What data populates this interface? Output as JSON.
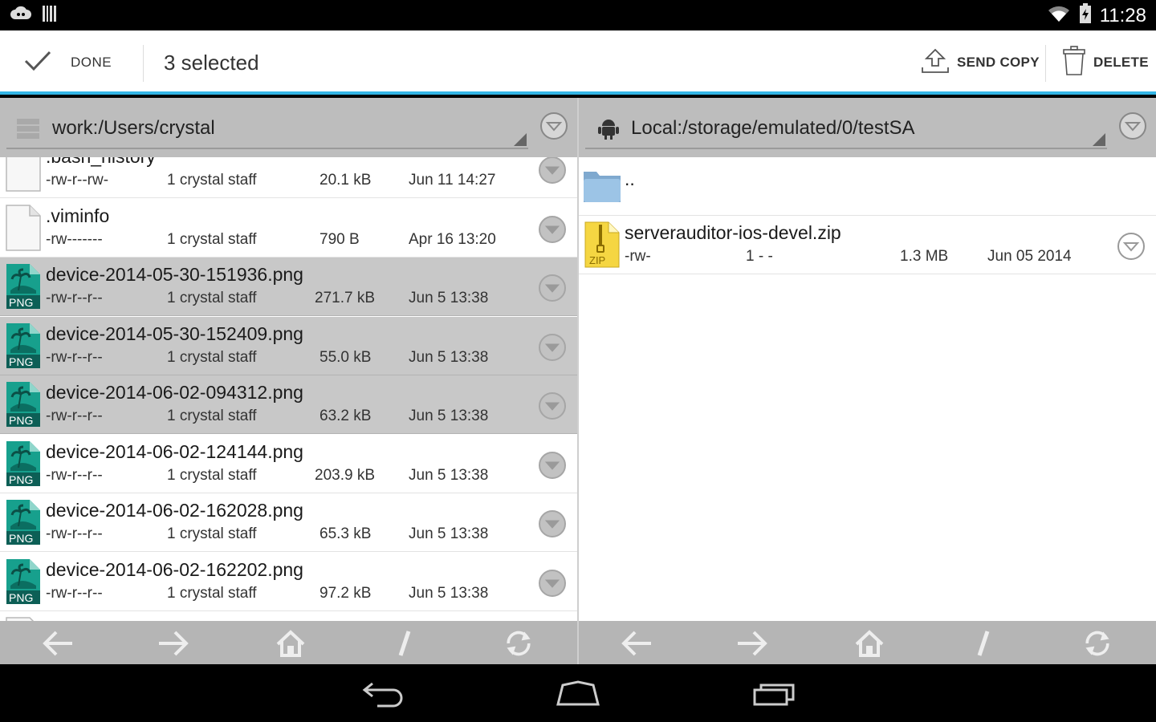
{
  "status": {
    "time": "11:28"
  },
  "actionbar": {
    "done_label": "DONE",
    "selected_label": "3 selected",
    "send_copy_label": "SEND COPY",
    "delete_label": "DELETE"
  },
  "left_pane": {
    "path": "work:/Users/crystal",
    "rows": [
      {
        "name": ".bash_history",
        "perms": "-rw-r--rw-",
        "owner": "1 crystal staff",
        "size": "20.1 kB",
        "date": "Jun 11 14:27",
        "type": "file",
        "selected": false
      },
      {
        "name": ".viminfo",
        "perms": "-rw-------",
        "owner": "1 crystal staff",
        "size": "790 B",
        "date": "Apr 16 13:20",
        "type": "file",
        "selected": false
      },
      {
        "name": "device-2014-05-30-151936.png",
        "perms": "-rw-r--r--",
        "owner": "1 crystal staff",
        "size": "271.7 kB",
        "date": "Jun 5 13:38",
        "type": "png",
        "selected": true
      },
      {
        "name": "device-2014-05-30-152409.png",
        "perms": "-rw-r--r--",
        "owner": "1 crystal staff",
        "size": "55.0 kB",
        "date": "Jun 5 13:38",
        "type": "png",
        "selected": true
      },
      {
        "name": "device-2014-06-02-094312.png",
        "perms": "-rw-r--r--",
        "owner": "1 crystal staff",
        "size": "63.2 kB",
        "date": "Jun 5 13:38",
        "type": "png",
        "selected": true
      },
      {
        "name": "device-2014-06-02-124144.png",
        "perms": "-rw-r--r--",
        "owner": "1 crystal staff",
        "size": "203.9 kB",
        "date": "Jun 5 13:38",
        "type": "png",
        "selected": false
      },
      {
        "name": "device-2014-06-02-162028.png",
        "perms": "-rw-r--r--",
        "owner": "1 crystal staff",
        "size": "65.3 kB",
        "date": "Jun 5 13:38",
        "type": "png",
        "selected": false
      },
      {
        "name": "device-2014-06-02-162202.png",
        "perms": "-rw-r--r--",
        "owner": "1 crystal staff",
        "size": "97.2 kB",
        "date": "Jun 5 13:38",
        "type": "png",
        "selected": false
      }
    ]
  },
  "right_pane": {
    "path": "Local:/storage/emulated/0/testSA",
    "parent_label": "..",
    "rows": [
      {
        "name": "serverauditor-ios-devel.zip",
        "perms": "-rw-",
        "owner": "1 - -",
        "size": "1.3 MB",
        "date": "Jun 05 2014",
        "type": "zip"
      }
    ]
  },
  "icons": {
    "png_label": "PNG",
    "zip_label": "ZIP",
    "toolbar": [
      "back-arrow-icon",
      "forward-arrow-icon",
      "home-icon",
      "root-slash-icon",
      "refresh-icon"
    ],
    "nav": [
      "nav-back-icon",
      "nav-home-icon",
      "nav-recents-icon"
    ]
  },
  "colors": {
    "accent": "#33b5e5",
    "png_icon": "#1a9e8c",
    "zip_icon": "#f5d642",
    "folder": "#8ab6da",
    "selected_row": "#c8c8c8"
  }
}
